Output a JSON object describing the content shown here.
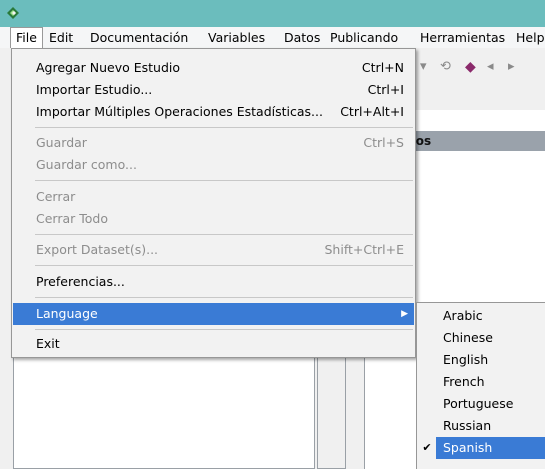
{
  "menubar": {
    "items": [
      {
        "label": "File"
      },
      {
        "label": "Edit"
      },
      {
        "label": "Documentación"
      },
      {
        "label": "Variables"
      },
      {
        "label": "Datos"
      },
      {
        "label": "Publicando"
      },
      {
        "label": "Herramientas"
      },
      {
        "label": "Help"
      }
    ]
  },
  "panel": {
    "header": "Proyectos"
  },
  "file_menu": {
    "items": [
      {
        "label": "Agregar Nuevo Estudio",
        "shortcut": "Ctrl+N"
      },
      {
        "label": "Importar Estudio...",
        "shortcut": "Ctrl+I"
      },
      {
        "label": "Importar Múltiples Operaciones Estadísticas...",
        "shortcut": "Ctrl+Alt+I"
      },
      {
        "label": "Guardar",
        "shortcut": "Ctrl+S"
      },
      {
        "label": "Guardar como...",
        "shortcut": ""
      },
      {
        "label": "Cerrar",
        "shortcut": ""
      },
      {
        "label": "Cerrar Todo",
        "shortcut": ""
      },
      {
        "label": "Export Dataset(s)...",
        "shortcut": "Shift+Ctrl+E"
      },
      {
        "label": "Preferencias...",
        "shortcut": ""
      },
      {
        "label": "Language",
        "shortcut": ""
      },
      {
        "label": "Exit",
        "shortcut": ""
      }
    ]
  },
  "language_menu": {
    "items": [
      {
        "label": "Arabic"
      },
      {
        "label": "Chinese"
      },
      {
        "label": "English"
      },
      {
        "label": "French"
      },
      {
        "label": "Portuguese"
      },
      {
        "label": "Russian"
      },
      {
        "label": "Spanish"
      }
    ],
    "selected": "Spanish"
  },
  "colors": {
    "titlebar": "#6bbdbd",
    "highlight": "#3a7bd5",
    "panel_header": "#9aa2ab"
  }
}
